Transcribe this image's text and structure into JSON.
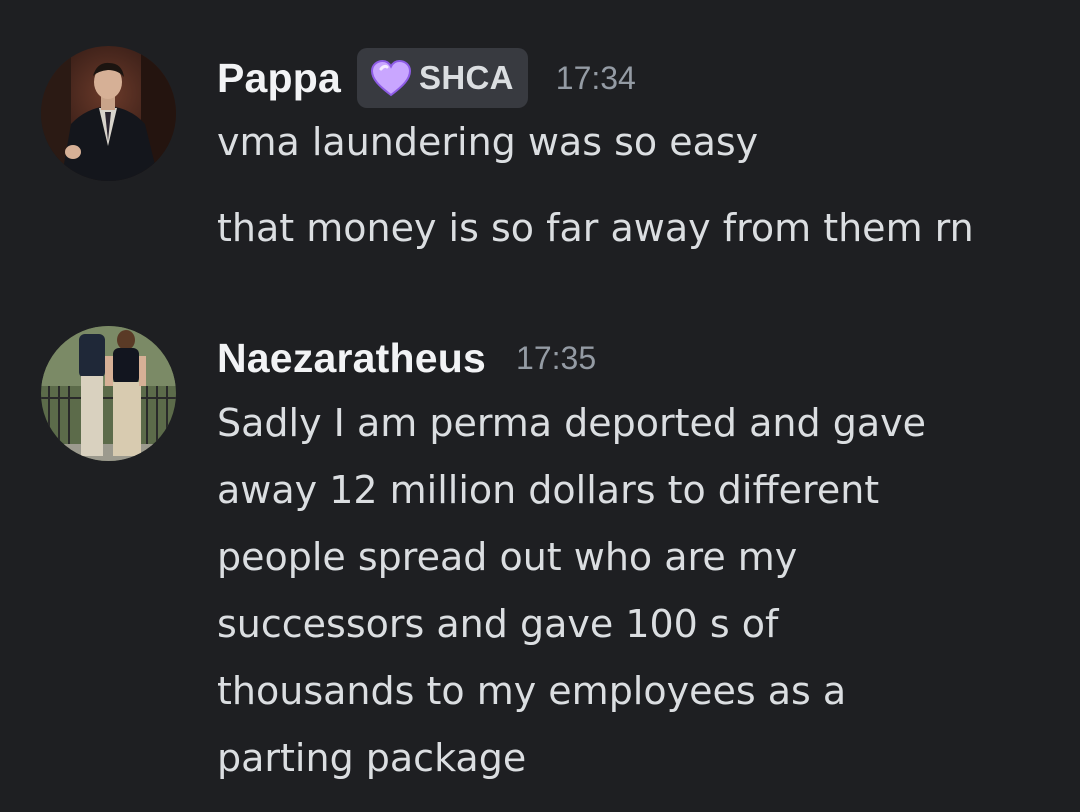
{
  "messages": [
    {
      "username": "Pappa",
      "tag": {
        "icon": "purple-heart-icon",
        "label": "SHCA"
      },
      "timestamp": "17:34",
      "avatar": "avatar-man-in-suit",
      "lines": [
        "vma laundering was so easy",
        "that money is so far away from them rn"
      ]
    },
    {
      "username": "Naezaratheus",
      "timestamp": "17:35",
      "avatar": "avatar-couple-photo",
      "lines": [
        "Sadly I am perma deported and gave",
        "away 12 million dollars to different",
        "people spread out who are my",
        "successors  and gave 100 s of",
        "thousands to my employees as a",
        "parting package"
      ]
    }
  ],
  "colors": {
    "background": "#1e1f22",
    "username": "#f2f3f5",
    "text": "#dbdee1",
    "timestamp": "#949ba4",
    "tag_bg": "#383a40",
    "heart": "#b57cf2"
  }
}
